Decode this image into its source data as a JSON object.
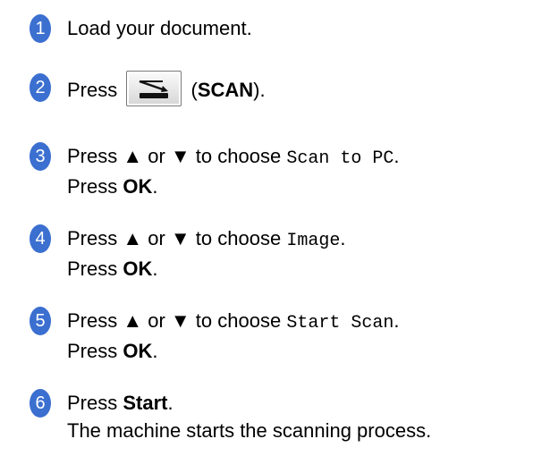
{
  "steps": [
    {
      "number": "1",
      "lines": [
        "Load your document."
      ]
    },
    {
      "number": "2",
      "prefix": "Press",
      "button_icon": "scan-icon",
      "paren_open": " (",
      "bold": "SCAN",
      "paren_close": ")."
    },
    {
      "number": "3",
      "line1_prefix": "Press ▲ or ▼ to choose ",
      "line1_mono": "Scan to PC",
      "line1_suffix": ".",
      "line2_prefix": "Press ",
      "line2_bold": "OK",
      "line2_suffix": "."
    },
    {
      "number": "4",
      "line1_prefix": "Press ▲ or ▼ to choose ",
      "line1_mono": "Image",
      "line1_suffix": ".",
      "line2_prefix": "Press ",
      "line2_bold": "OK",
      "line2_suffix": "."
    },
    {
      "number": "5",
      "line1_prefix": "Press ▲ or ▼ to choose ",
      "line1_mono": "Start Scan",
      "line1_suffix": ".",
      "line2_prefix": "Press ",
      "line2_bold": "OK",
      "line2_suffix": "."
    },
    {
      "number": "6",
      "line1_prefix": "Press ",
      "line1_bold": "Start",
      "line1_suffix": ".",
      "line2": "The machine starts the scanning process."
    }
  ],
  "colors": {
    "badge": "#3b6fd0"
  }
}
